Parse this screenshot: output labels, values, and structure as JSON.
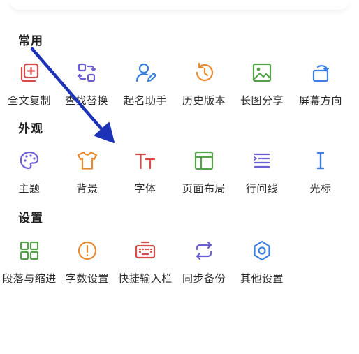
{
  "sections": [
    {
      "title": "常用",
      "items": [
        {
          "label": "全文复制",
          "icon": "copy-icon"
        },
        {
          "label": "查找替换",
          "icon": "find-replace-icon"
        },
        {
          "label": "起名助手",
          "icon": "user-edit-icon"
        },
        {
          "label": "历史版本",
          "icon": "history-icon"
        },
        {
          "label": "长图分享",
          "icon": "image-icon"
        },
        {
          "label": "屏幕方向",
          "icon": "rotate-screen-icon"
        }
      ]
    },
    {
      "title": "外观",
      "items": [
        {
          "label": "主题",
          "icon": "palette-icon"
        },
        {
          "label": "背景",
          "icon": "tshirt-icon"
        },
        {
          "label": "字体",
          "icon": "font-icon"
        },
        {
          "label": "页面布局",
          "icon": "layout-icon"
        },
        {
          "label": "行间线",
          "icon": "line-spacing-icon"
        },
        {
          "label": "光标",
          "icon": "cursor-icon"
        }
      ]
    },
    {
      "title": "设置",
      "items": [
        {
          "label": "段落与缩进",
          "icon": "grid-icon"
        },
        {
          "label": "字数设置",
          "icon": "alert-circle-icon"
        },
        {
          "label": "快捷输入栏",
          "icon": "keyboard-icon"
        },
        {
          "label": "同步备份",
          "icon": "sync-icon"
        },
        {
          "label": "其他设置",
          "icon": "gear-icon"
        }
      ]
    }
  ],
  "colors": {
    "red": "#d94a4a",
    "purple": "#6b5fd3",
    "blue": "#3b7fe0",
    "orange": "#ea8a2f",
    "green": "#54a34a",
    "arrow": "#1d33b7"
  }
}
